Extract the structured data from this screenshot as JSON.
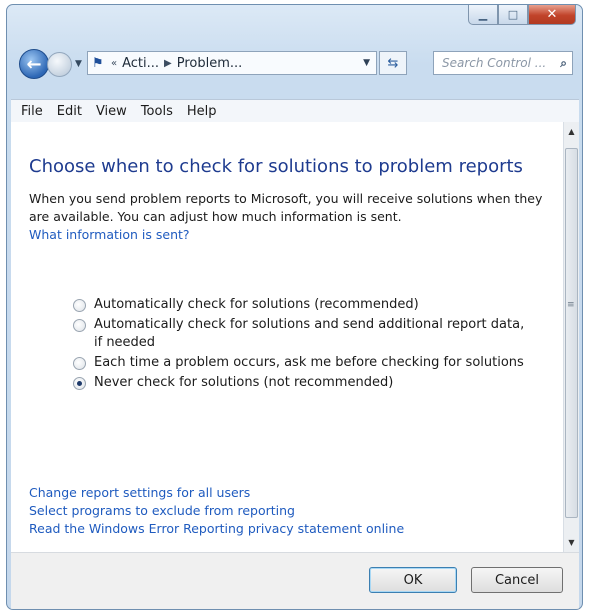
{
  "nav": {
    "breadcrumb_1": "Acti...",
    "breadcrumb_2": "Problem...",
    "search_placeholder": "Search Control ..."
  },
  "menu": [
    "File",
    "Edit",
    "View",
    "Tools",
    "Help"
  ],
  "main": {
    "title": "Choose when to check for solutions to problem reports",
    "intro": "When you send problem reports to Microsoft, you will receive solutions when they are available. You can adjust how much information is sent.",
    "info_link": "What information is sent?",
    "options": [
      {
        "label": "Automatically check for solutions (recommended)",
        "selected": false
      },
      {
        "label": "Automatically check for solutions and send additional report data, if needed",
        "selected": false
      },
      {
        "label": "Each time a problem occurs, ask me before checking for solutions",
        "selected": false
      },
      {
        "label": "Never check for solutions (not recommended)",
        "selected": true
      }
    ],
    "links": [
      "Change report settings for all users",
      "Select programs to exclude from reporting",
      "Read the Windows Error Reporting privacy statement online"
    ]
  },
  "footer": {
    "ok_label": "OK",
    "cancel_label": "Cancel"
  },
  "colors": {
    "title": "#1e3b8f",
    "link": "#1f5bbf",
    "close_button": "#c1432a"
  },
  "icons": [
    "back-arrow-icon",
    "forward-arrow-icon",
    "control-panel-flag-icon",
    "refresh-icon",
    "search-icon",
    "minimize-icon",
    "maximize-icon",
    "close-icon"
  ]
}
